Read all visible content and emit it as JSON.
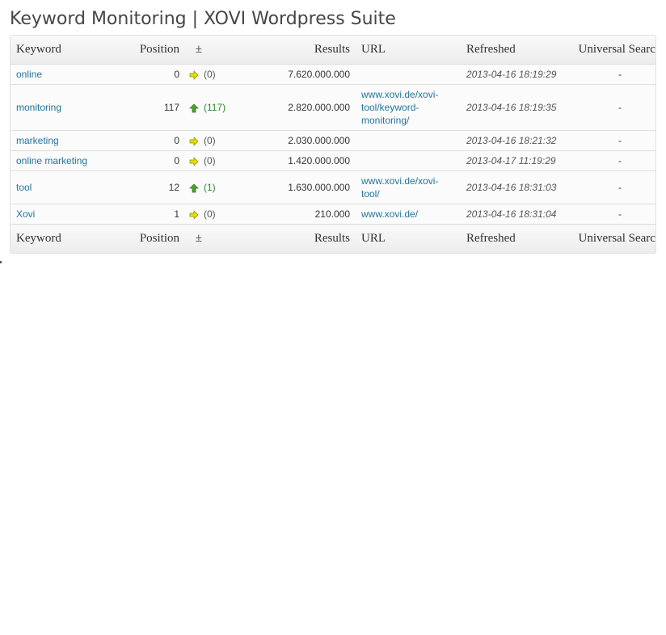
{
  "page": {
    "title": "Keyword Monitoring | XOVI Wordpress Suite"
  },
  "table": {
    "headers": {
      "keyword": "Keyword",
      "position": "Position",
      "diff": "±",
      "results": "Results",
      "url": "URL",
      "refreshed": "Refreshed",
      "universal_search": "Universal Search"
    },
    "rows": [
      {
        "keyword": "online",
        "position": "0",
        "trend": "same",
        "trend_icon": "arrow-right-icon",
        "diff": "(0)",
        "results": "7.620.000.000",
        "url": "",
        "refreshed": "2013-04-16 18:19:29",
        "universal_search": "-"
      },
      {
        "keyword": "monitoring",
        "position": "117",
        "trend": "up",
        "trend_icon": "arrow-up-icon",
        "diff": "(117)",
        "results": "2.820.000.000",
        "url": "www.xovi.de/xovi-tool/keyword-monitoring/",
        "refreshed": "2013-04-16 18:19:35",
        "universal_search": "-"
      },
      {
        "keyword": "marketing",
        "position": "0",
        "trend": "same",
        "trend_icon": "arrow-right-icon",
        "diff": "(0)",
        "results": "2.030.000.000",
        "url": "",
        "refreshed": "2013-04-16 18:21:32",
        "universal_search": "-"
      },
      {
        "keyword": "online marketing",
        "position": "0",
        "trend": "same",
        "trend_icon": "arrow-right-icon",
        "diff": "(0)",
        "results": "1.420.000.000",
        "url": "",
        "refreshed": "2013-04-17 11:19:29",
        "universal_search": "-"
      },
      {
        "keyword": "tool",
        "position": "12",
        "trend": "up",
        "trend_icon": "arrow-up-icon",
        "diff": "(1)",
        "results": "1.630.000.000",
        "url": "www.xovi.de/xovi-tool/",
        "refreshed": "2013-04-16 18:31:03",
        "universal_search": "-"
      },
      {
        "keyword": "Xovi",
        "position": "1",
        "trend": "same",
        "trend_icon": "arrow-right-icon",
        "diff": "(0)",
        "results": "210.000",
        "url": "www.xovi.de/",
        "refreshed": "2013-04-16 18:31:04",
        "universal_search": "-"
      }
    ]
  },
  "colors": {
    "link": "#21759b",
    "trend_up_arrow": "#4aa32a",
    "trend_same_arrow": "#e3e000",
    "trend_up_text": "#2e8b2e",
    "header_bg_top": "#f9f9f9",
    "header_bg_bottom": "#ececec",
    "border": "#dfdfdf"
  }
}
